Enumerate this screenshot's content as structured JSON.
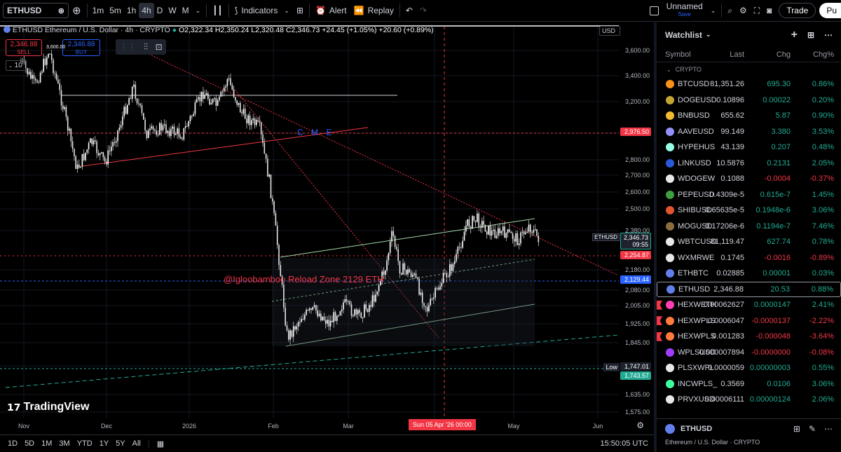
{
  "topbar": {
    "symbol": "ETHUSD",
    "timeframes": [
      "1m",
      "5m",
      "1h",
      "4h",
      "D",
      "W",
      "M"
    ],
    "active_tf": "4h",
    "indicators_label": "Indicators",
    "alert_label": "Alert",
    "replay_label": "Replay",
    "layout_name": "Unnamed",
    "layout_status": "Save",
    "trade_label": "Trade",
    "publish_label": "Pu"
  },
  "legend": {
    "title": "Ethereum / U.S. Dollar · 4h · CRYPTO",
    "symbol": "ETHUSD",
    "ohlc": "O2,322.34 H2,350.24 L2,320.48 C2,346.73 +24.45 (+1.05%) +20.60 (+0.89%)",
    "sell_price": "2,346.88",
    "sell_label": "SELL",
    "buy_price": "2,346.88",
    "buy_label": "BUY",
    "qty": "10",
    "currency": "USD"
  },
  "annotations": {
    "cme": "C M E",
    "reload_zone": "@Igloobamboo Reload Zone 2129 ETH",
    "tv_logo": "TradingView",
    "top_label_value": "3,600.00"
  },
  "price_axis": {
    "ticks": [
      "3,600.00",
      "3,400.00",
      "3,200.00",
      "2,976.50",
      "2,800.00",
      "2,700.00",
      "2,600.00",
      "2,500.00",
      "2,380.00",
      "2,180.00",
      "2,080.00",
      "2,005.00",
      "1,925.00",
      "1,845.00",
      "1,747.01",
      "1,635.00",
      "1,575.00"
    ],
    "last_tag": "2,346.73",
    "countdown": "09:55",
    "symbol_tag": "ETHUSD",
    "red_tag_1": "2,976.50",
    "red_tag_2": "2,254.87",
    "blue_tag": "2,129.44",
    "low_label": "Low",
    "low_value": "1,747.01",
    "green_tag": "1,743.57"
  },
  "time_axis": {
    "labels": [
      "Nov",
      "Dec",
      "2026",
      "Feb",
      "Mar",
      "Apr",
      "May",
      "Jun"
    ],
    "cursor_label": "Sun 05 Apr '26   00:00"
  },
  "bottombar": {
    "ranges": [
      "1D",
      "5D",
      "1M",
      "3M",
      "YTD",
      "1Y",
      "5Y",
      "All"
    ],
    "clock": "15:50:05 UTC"
  },
  "watchlist": {
    "title": "Watchlist",
    "columns": [
      "Symbol",
      "Last",
      "Chg",
      "Chg%"
    ],
    "section": "CRYPTO",
    "rows": [
      {
        "symbol": "BTCUSD",
        "last": "81,351.26",
        "chg": "695.30",
        "pct": "0.86%",
        "dir": "pos",
        "color": "#f7931a",
        "flag": false
      },
      {
        "symbol": "DOGEUSD",
        "last": "0.10896",
        "chg": "0.00022",
        "pct": "0.20%",
        "dir": "pos",
        "color": "#c2a633",
        "flag": false
      },
      {
        "symbol": "BNBUSD",
        "last": "655.62",
        "chg": "5.87",
        "pct": "0.90%",
        "dir": "pos",
        "color": "#f3ba2f",
        "flag": false
      },
      {
        "symbol": "AAVEUSD",
        "last": "99.149",
        "chg": "3.380",
        "pct": "3.53%",
        "dir": "pos",
        "color": "#9391f7",
        "flag": false
      },
      {
        "symbol": "HYPEHUS",
        "last": "43.139",
        "chg": "0.207",
        "pct": "0.48%",
        "dir": "pos",
        "color": "#97fce4",
        "flag": false
      },
      {
        "symbol": "LINKUSD",
        "last": "10.5876",
        "chg": "0.2131",
        "pct": "2.05%",
        "dir": "pos",
        "color": "#2a5ada",
        "flag": false
      },
      {
        "symbol": "WDOGEW",
        "last": "0.1088",
        "chg": "-0.0004",
        "pct": "-0.37%",
        "dir": "neg",
        "color": "#e8e8e8",
        "flag": false
      },
      {
        "symbol": "PEPEUSD",
        "last": "0.4309e-5",
        "chg": "0.615e-7",
        "pct": "1.45%",
        "dir": "pos",
        "color": "#3d9f3d",
        "flag": false
      },
      {
        "symbol": "SHIBUSD",
        "last": "0.65635e-5",
        "chg": "0.1948e-6",
        "pct": "3.06%",
        "dir": "pos",
        "color": "#e0542e",
        "flag": false
      },
      {
        "symbol": "MOGUSD",
        "last": "0.17206e-6",
        "chg": "0.1194e-7",
        "pct": "7.46%",
        "dir": "pos",
        "color": "#8a6d3b",
        "flag": false
      },
      {
        "symbol": "WBTCUSD",
        "last": "81,119.47",
        "chg": "627.74",
        "pct": "0.78%",
        "dir": "pos",
        "color": "#e8e8e8",
        "flag": false
      },
      {
        "symbol": "WXMRWE",
        "last": "0.1745",
        "chg": "-0.0016",
        "pct": "-0.89%",
        "dir": "neg",
        "color": "#e8e8e8",
        "flag": false
      },
      {
        "symbol": "ETHBTC",
        "last": "0.02885",
        "chg": "0.00001",
        "pct": "0.03%",
        "dir": "pos",
        "color": "#627eea",
        "flag": false
      },
      {
        "symbol": "ETHUSD",
        "last": "2,346.88",
        "chg": "20.53",
        "pct": "0.88%",
        "dir": "pos",
        "color": "#627eea",
        "flag": false,
        "selected": true
      },
      {
        "symbol": "HEXWETH",
        "last": "0.00062627",
        "chg": "0.0000147",
        "pct": "2.41%",
        "dir": "pos",
        "color": "#ff3db5",
        "flag": true
      },
      {
        "symbol": "HEXWPLS",
        "last": "0.0006047",
        "chg": "-0.0000137",
        "pct": "-2.22%",
        "dir": "neg",
        "color": "#ff7a3d",
        "flag": true
      },
      {
        "symbol": "HEXWPLS",
        "last": "0.001283",
        "chg": "-0.000048",
        "pct": "-3.64%",
        "dir": "neg",
        "color": "#ff7a3d",
        "flag": true
      },
      {
        "symbol": "WPLSUSD",
        "last": "0.000007894",
        "chg": "-0.0000000",
        "pct": "-0.08%",
        "dir": "neg",
        "color": "#a23dff",
        "flag": false
      },
      {
        "symbol": "PLSXWPL",
        "last": "0.0000059",
        "chg": "0.00000003",
        "pct": "0.55%",
        "dir": "pos",
        "color": "#e8e8e8",
        "flag": false
      },
      {
        "symbol": "INCWPLS_",
        "last": "0.3569",
        "chg": "0.0106",
        "pct": "3.06%",
        "dir": "pos",
        "color": "#3dff9e",
        "flag": false
      },
      {
        "symbol": "PRVXUSD",
        "last": "0.00006111",
        "chg": "0.00000124",
        "pct": "2.06%",
        "dir": "pos",
        "color": "#e8e8e8",
        "flag": false
      }
    ],
    "detail_symbol": "ETHUSD",
    "detail_desc": "Ethereum / U.S. Dollar · CRYPTO"
  },
  "colors": {
    "up": "#22ab94",
    "down": "#f23645",
    "accent": "#2962ff",
    "cursor": "#f23645"
  }
}
